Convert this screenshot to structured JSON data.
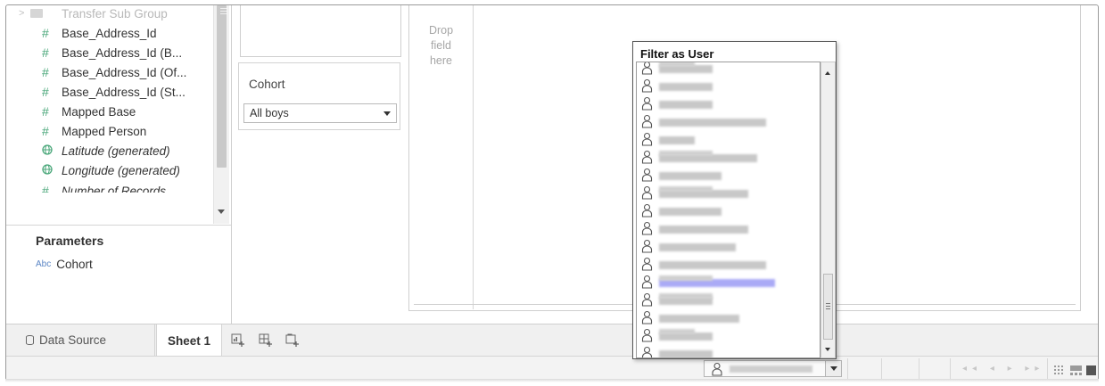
{
  "data_pane": {
    "fields": [
      {
        "label": "Transfer Sub Group",
        "icon": "folder-icon",
        "style": "faded"
      },
      {
        "label": "Base_Address_Id",
        "icon": "hash-icon",
        "style": "normal"
      },
      {
        "label": "Base_Address_Id (B...",
        "icon": "hash-icon",
        "style": "normal"
      },
      {
        "label": "Base_Address_Id (Of...",
        "icon": "hash-icon",
        "style": "normal"
      },
      {
        "label": "Base_Address_Id (St...",
        "icon": "hash-icon",
        "style": "normal"
      },
      {
        "label": "Mapped Base",
        "icon": "hash-icon",
        "style": "normal"
      },
      {
        "label": "Mapped Person",
        "icon": "hash-icon",
        "style": "normal"
      },
      {
        "label": "Latitude (generated)",
        "icon": "globe-icon",
        "style": "italic"
      },
      {
        "label": "Longitude (generated)",
        "icon": "globe-icon",
        "style": "italic"
      },
      {
        "label": "Number of Records",
        "icon": "hash-icon",
        "style": "italic"
      }
    ]
  },
  "parameters": {
    "title": "Parameters",
    "items": [
      {
        "type_badge": "Abc",
        "label": "Cohort"
      }
    ]
  },
  "filter_card": {
    "title": "Cohort",
    "selected": "All boys"
  },
  "drop_hint": {
    "line1": "Drop",
    "line2": "field",
    "line3": "here"
  },
  "popup": {
    "title": "Filter as User",
    "user_count": 17,
    "selected_index": 12
  },
  "tabs": {
    "data_source": "Data Source",
    "sheet": "Sheet 1",
    "new_sheet_icon": "new-worksheet-icon",
    "new_dashboard_icon": "new-dashboard-icon",
    "new_story_icon": "new-story-icon"
  },
  "status_bar": {
    "user_icon": "user-icon",
    "nav": "◂◂ ◂ ▸ ▸▸"
  },
  "colors": {
    "measure_green": "#4aa77a",
    "param_blue": "#5b86c5",
    "selection_highlight": "#aaaaf6"
  }
}
